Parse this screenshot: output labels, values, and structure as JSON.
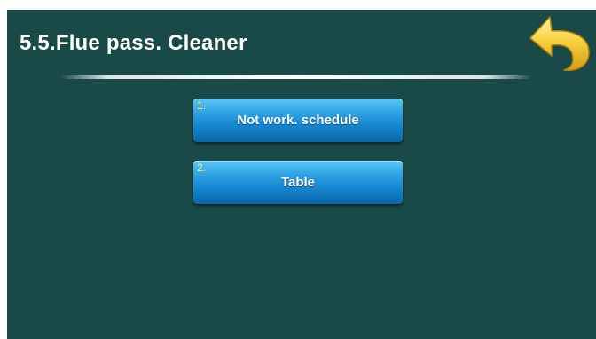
{
  "header": {
    "title": "5.5.Flue pass. Cleaner"
  },
  "back_button": {
    "icon": "back-arrow-icon",
    "color": "#f5c730"
  },
  "menu": {
    "items": [
      {
        "number": "1.",
        "label": "Not work. schedule"
      },
      {
        "number": "2.",
        "label": "Table"
      }
    ]
  },
  "colors": {
    "background": "#1a4a47",
    "button": "#1a8fd6",
    "item_number": "#ffee55",
    "back_arrow": "#f5c730"
  }
}
